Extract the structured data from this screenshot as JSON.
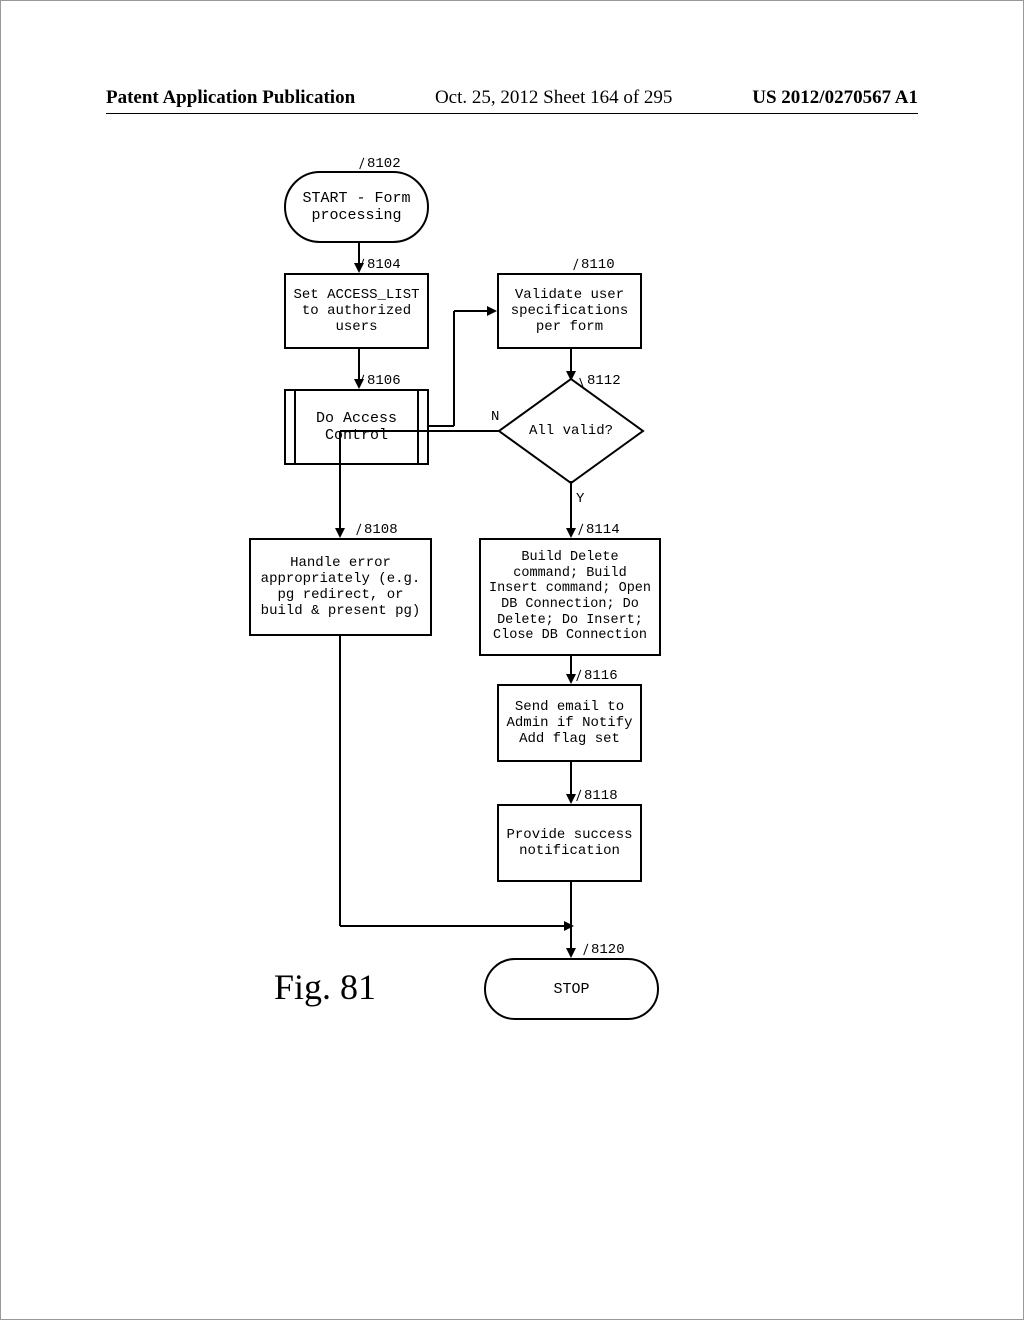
{
  "header": {
    "left": "Patent Application Publication",
    "center": "Oct. 25, 2012  Sheet 164 of 295",
    "right": "US 2012/0270567 A1"
  },
  "figure_label": "Fig. 81",
  "nodes": {
    "n8102": {
      "ref": "8102",
      "text": "START - Form processing"
    },
    "n8104": {
      "ref": "8104",
      "text": "Set ACCESS_LIST to authorized users"
    },
    "n8106": {
      "ref": "8106",
      "text": "Do Access Control"
    },
    "n8108": {
      "ref": "8108",
      "text": "Handle error appropriately (e.g. pg redirect, or build & present pg)"
    },
    "n8110": {
      "ref": "8110",
      "text": "Validate user specifications per form"
    },
    "n8112": {
      "ref": "8112",
      "text": "All valid?"
    },
    "n8114": {
      "ref": "8114",
      "text": "Build Delete command; Build Insert command; Open DB Connection; Do Delete; Do Insert; Close DB Connection"
    },
    "n8116": {
      "ref": "8116",
      "text": "Send email to Admin if Notify Add flag set"
    },
    "n8118": {
      "ref": "8118",
      "text": "Provide success notification"
    },
    "n8120": {
      "ref": "8120",
      "text": "STOP"
    }
  },
  "edge_labels": {
    "n8112_no": "N",
    "n8112_yes": "Y"
  }
}
